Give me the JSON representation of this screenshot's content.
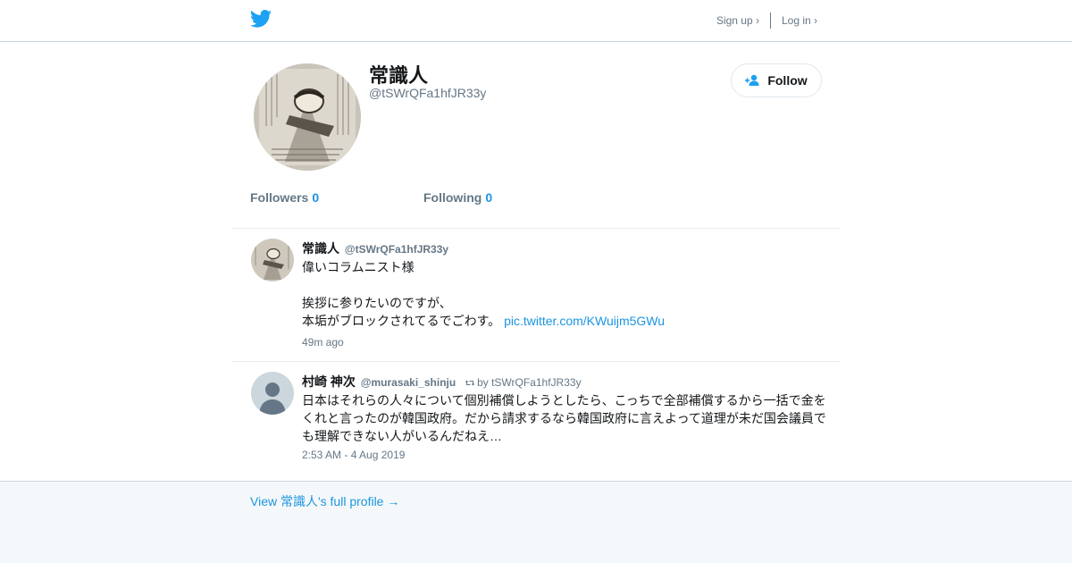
{
  "header": {
    "logo_icon": "twitter-bird-icon",
    "signup_label": "Sign up ›",
    "login_label": "Log in ›",
    "brand_color": "#1DA1F2"
  },
  "profile": {
    "name": "常識人",
    "handle": "@tSWrQFa1hfJR33y",
    "follow_label": "Follow",
    "followers_label": "Followers",
    "followers_count": "0",
    "following_label": "Following",
    "following_count": "0"
  },
  "tweets": [
    {
      "name": "常識人",
      "handle": "@tSWrQFa1hfJR33y",
      "retweet_by": "",
      "text_lines": [
        "偉いコラムニスト様",
        "",
        "挨拶に参りたいのですが、",
        "本垢がブロックされてるでごわす。"
      ],
      "link": "pic.twitter.com/KWuijm5GWu",
      "time": "49m ago"
    },
    {
      "name": "村崎 神次",
      "handle": "@murasaki_shinju",
      "retweet_by": "by tSWrQFa1hfJR33y",
      "text": "日本はそれらの人々について個別補償しようとしたら、こっちで全部補償するから一括で金をくれと言ったのが韓国政府。だから請求するなら韓国政府に言えよって道理が未だ国会議員でも理解できない人がいるんだねえ…",
      "time": "2:53 AM - 4 Aug 2019"
    }
  ],
  "footer": {
    "view_profile_label": "View 常識人's full profile →"
  }
}
